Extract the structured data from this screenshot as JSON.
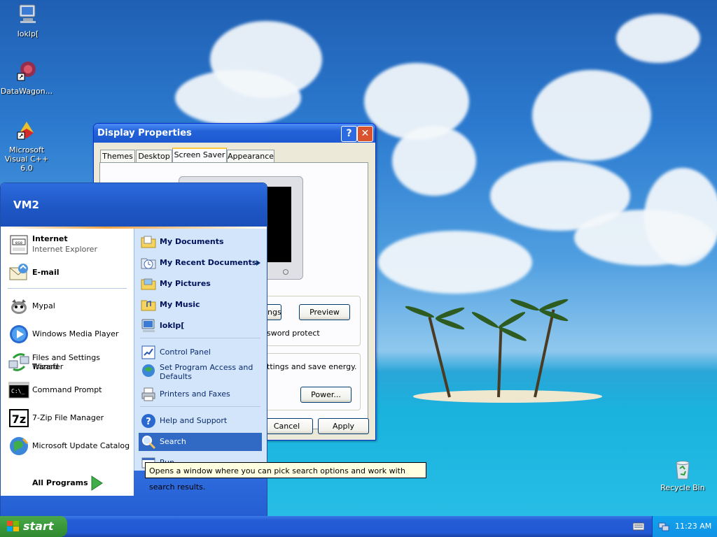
{
  "desktop": {
    "icons": [
      {
        "label": "loklp[",
        "icon": "computer-icon"
      },
      {
        "label": "DataWagon...",
        "icon": "datawagon-icon"
      },
      {
        "label": "Microsoft Visual C++ 6.0",
        "icon": "visual-cpp-icon"
      }
    ],
    "recycle_bin": {
      "label": "Recycle Bin",
      "icon": "recycle-bin-icon"
    }
  },
  "display_properties": {
    "title": "Display Properties",
    "help_glyph": "?",
    "close_glyph": "✕",
    "tabs": [
      "Themes",
      "Desktop",
      "Screen Saver",
      "Appearance"
    ],
    "selected_tab": "Screen Saver",
    "settings_btn": "ings",
    "preview_btn": "Preview",
    "password_text": "sword protect",
    "energy_text": "ttings and save energy.",
    "power_btn": "Power...",
    "cancel_btn": "Cancel",
    "apply_btn": "Apply"
  },
  "start_menu": {
    "user": "VM2",
    "pinned": [
      {
        "title": "Internet",
        "subtitle": "Internet Explorer",
        "icon": "internet-explorer-icon"
      },
      {
        "title": "E-mail",
        "subtitle": "",
        "icon": "email-icon"
      }
    ],
    "recent": [
      {
        "title": "Mypal",
        "icon": "mypal-icon"
      },
      {
        "title": "Windows Media Player",
        "icon": "media-player-icon"
      },
      {
        "title": "Files and Settings Transfer",
        "title2": "Wizard",
        "icon": "transfer-wizard-icon"
      },
      {
        "title": "Command Prompt",
        "icon": "command-prompt-icon"
      },
      {
        "title": "7-Zip File Manager",
        "icon": "7zip-icon"
      },
      {
        "title": "Microsoft Update Catalog",
        "icon": "update-catalog-icon"
      }
    ],
    "all_programs": "All Programs",
    "places": [
      {
        "title": "My Documents",
        "icon": "folder-icon"
      },
      {
        "title": "My Recent Documents",
        "icon": "recent-documents-icon"
      },
      {
        "title": "My Pictures",
        "icon": "folder-icon"
      },
      {
        "title": "My Music",
        "icon": "folder-icon"
      },
      {
        "title": "loklp[",
        "icon": "computer-icon"
      }
    ],
    "system": [
      {
        "title": "Control Panel",
        "icon": "control-panel-icon"
      },
      {
        "title": "Set Program Access and",
        "title2": "Defaults",
        "icon": "program-access-icon"
      },
      {
        "title": "Printers and Faxes",
        "icon": "printer-icon"
      }
    ],
    "help": [
      {
        "title": "Help and Support",
        "icon": "help-icon"
      },
      {
        "title": "Search",
        "icon": "search-icon"
      },
      {
        "title": "Run...",
        "icon": "run-icon"
      }
    ],
    "tooltip": "Opens a window where you can pick search options and work with search results."
  },
  "taskbar": {
    "start_label": "start",
    "clock": "11:23 AM"
  }
}
